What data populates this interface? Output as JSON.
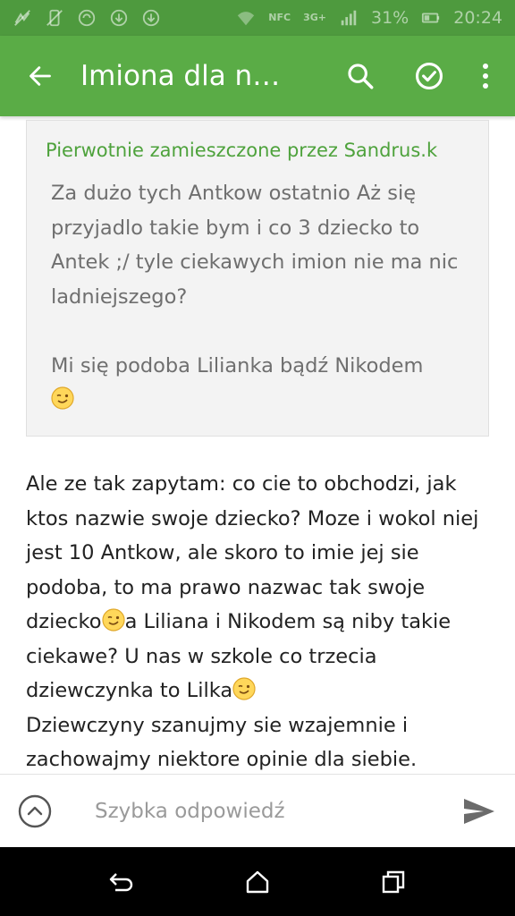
{
  "status_bar": {
    "network": "3G+",
    "nfc": "NFC",
    "battery": "31%",
    "time": "20:24"
  },
  "app_bar": {
    "title": "Imiona dla na…",
    "icons": [
      "back-arrow-icon",
      "search-icon",
      "check-circle-icon",
      "more-vert-icon"
    ]
  },
  "quote": {
    "author_line": "Pierwotnie zamieszczone przez Sandrus.k",
    "text": "Za dużo tych Antkow ostatnio Aż się przyjadlo takie bym i co 3 dziecko to Antek ;/ tyle ciekawych imion nie ma nic ladniejszego?\n\nMi się podoba Lilianka bądź Nikodem"
  },
  "post": {
    "part1": "Ale ze tak zapytam: co cie to obchodzi, jak ktos nazwie swoje dziecko? Moze i wokol niej jest 10 Antkow, ale skoro to imie jej sie podoba, to ma prawo nazwac tak swoje dziecko",
    "part2": "a Liliana i Nikodem są niby takie ciekawe? U nas w szkole co trzecia dziewczynka to Lilka",
    "part3": "Dziewczyny szanujmy sie wzajemnie i zachowajmy niektore opinie dla siebie."
  },
  "reply": {
    "placeholder": "Szybka odpowiedź"
  },
  "colors": {
    "status_bar": "#4e9a3e",
    "app_bar": "#5aac46",
    "accent": "#4ea23c",
    "quote_bg": "#f3f3f3"
  }
}
